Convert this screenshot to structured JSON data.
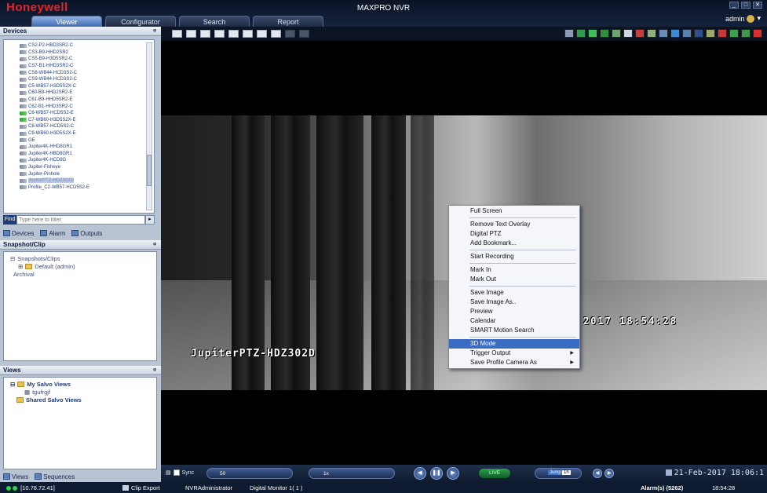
{
  "app": {
    "brand": "Honeywell",
    "title": "MAXPRO NVR",
    "user": "admin",
    "tabs": [
      {
        "label": "Viewer",
        "active": true
      },
      {
        "label": "Configurator",
        "active": false
      },
      {
        "label": "Search",
        "active": false
      },
      {
        "label": "Report",
        "active": false
      }
    ]
  },
  "devices_panel": {
    "title": "Devices",
    "items": [
      {
        "label": "CS2-P2-HBD3SR2-C"
      },
      {
        "label": "CS3-B9-HHD2SR2"
      },
      {
        "label": "CS5-B9-H3D5SR2-C"
      },
      {
        "label": "CS7-B1-HHD3SR2-C"
      },
      {
        "label": "CS8-WB44-HCD3S2-C"
      },
      {
        "label": "CS9-WB44-HCD3S2-C"
      },
      {
        "label": "C5-WB57-H3D5S2X-C"
      },
      {
        "label": "C60-B9-HHD2SR2-E"
      },
      {
        "label": "C61-B9-HHD5SR2-E"
      },
      {
        "label": "C62-B1-HHD3SR2-C"
      },
      {
        "label": "C6-WB57-HCD5S2-E"
      },
      {
        "label": "C7-WB60-H3D5S2X-E"
      },
      {
        "label": "C8-WB57-HCD5S2-C"
      },
      {
        "label": "C9-WB60-H3D5S2X-E"
      },
      {
        "label": "GE"
      },
      {
        "label": "Jupiter4K-HHD8GR1"
      },
      {
        "label": "Jupiter4K-HBD8GR1"
      },
      {
        "label": "Jupiter4K-HCD8G"
      },
      {
        "label": "Jupiter-Fisheye"
      },
      {
        "label": "Jupiter-Pinhole"
      },
      {
        "label": "JupiterPTZ-HDZ302D"
      },
      {
        "label": "Profile_C2-WB57-HCD5S2-E"
      }
    ],
    "selected_index": 20,
    "find_label": "Find",
    "filter_placeholder": "Type here to filter",
    "tabs": [
      "Devices",
      "Alarm",
      "Outputs"
    ]
  },
  "snapshot_panel": {
    "title": "Snapshot/Clip",
    "root": "Snapshots/Clips",
    "child": "Default (admin)",
    "archival": "Archival"
  },
  "views_panel": {
    "title": "Views",
    "my_views": "My Salvo Views",
    "my_view_item": "tgufrgjf",
    "shared_views": "Shared Salvo Views",
    "tabs": [
      "Views",
      "Sequences"
    ]
  },
  "video": {
    "camera_osd": "JupiterPTZ-HDZ302D",
    "time_osd": "2017 18:54:28"
  },
  "context_menu": {
    "groups": [
      [
        {
          "label": "Full Screen"
        }
      ],
      [
        {
          "label": "Remove Text Overlay"
        },
        {
          "label": "Digital PTZ"
        },
        {
          "label": "Add Bookmark..."
        }
      ],
      [
        {
          "label": "Start Recording"
        }
      ],
      [
        {
          "label": "Mark In"
        },
        {
          "label": "Mark Out"
        }
      ],
      [
        {
          "label": "Save Image"
        },
        {
          "label": "Save Image As.."
        },
        {
          "label": "Preview"
        },
        {
          "label": "Calendar"
        },
        {
          "label": "SMART Motion Search"
        }
      ],
      [
        {
          "label": "3D Mode",
          "highlighted": true
        },
        {
          "label": "Trigger Output",
          "submenu": true
        },
        {
          "label": "Save Profile Camera As",
          "submenu": true
        }
      ]
    ]
  },
  "playback": {
    "sync_label": "Sync",
    "speed_value": "50",
    "rate_value": "1x",
    "live_label": "LIVE",
    "jump_label": "Jump",
    "jump_value": "1h",
    "datetime": "21-Feb-2017 18:06:1"
  },
  "status_bar": {
    "ip": "[10.78.72.41]",
    "clip_export": "Clip Export",
    "role": "NVRAdministrator",
    "monitor": "Digital Monitor 1( 1 )",
    "alarms": "Alarm(s) (5262)",
    "time": "18:54:28"
  },
  "colors": {
    "brand_red": "#e8232a",
    "menu_highlight": "#3a6cc4",
    "active_tab": "#3f6bb1",
    "live_green": "#2e9f4b"
  }
}
